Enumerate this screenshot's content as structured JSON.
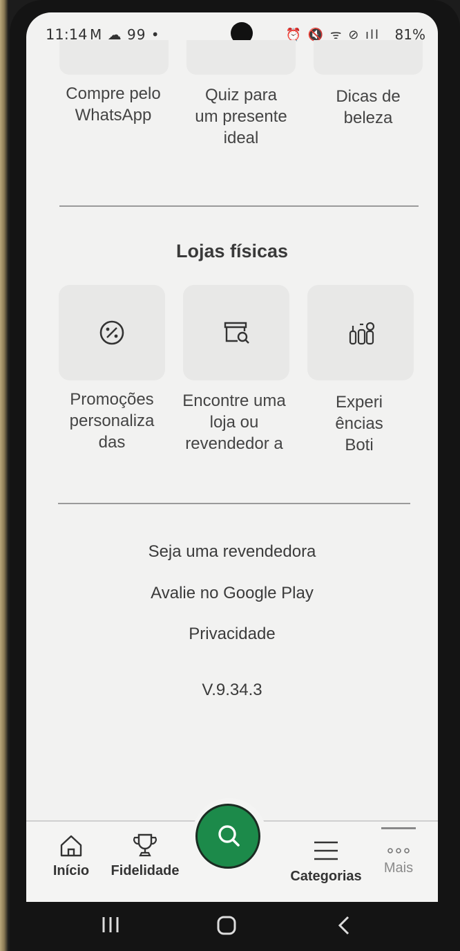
{
  "status_bar": {
    "time": "11:14",
    "left_icons": "M ☁ 99 •",
    "right_icons": "⏰ 🔇 ᯤ ⊘ ıll",
    "battery": "81%"
  },
  "top_shortcuts": [
    {
      "label": "Compre pelo WhatsApp"
    },
    {
      "label": "Quiz para um presente ideal"
    },
    {
      "label": "Dicas de beleza"
    }
  ],
  "physical_stores": {
    "title": "Lojas físicas",
    "items": [
      {
        "label": "Promoções personaliza das",
        "icon": "percent-badge-icon"
      },
      {
        "label": "Encontre uma loja ou revendedor a",
        "icon": "store-search-icon"
      },
      {
        "label": "Experi ências Boti",
        "icon": "cosmetics-bottles-icon"
      }
    ]
  },
  "links": {
    "reseller": "Seja uma revendedora",
    "rate": "Avalie no Google Play",
    "privacy": "Privacidade",
    "version": "V.9.34.3"
  },
  "bottom_nav": {
    "home": "Início",
    "loyalty": "Fidelidade",
    "categories": "Categorias",
    "more": "Mais",
    "accent": "#1c8a4a"
  }
}
